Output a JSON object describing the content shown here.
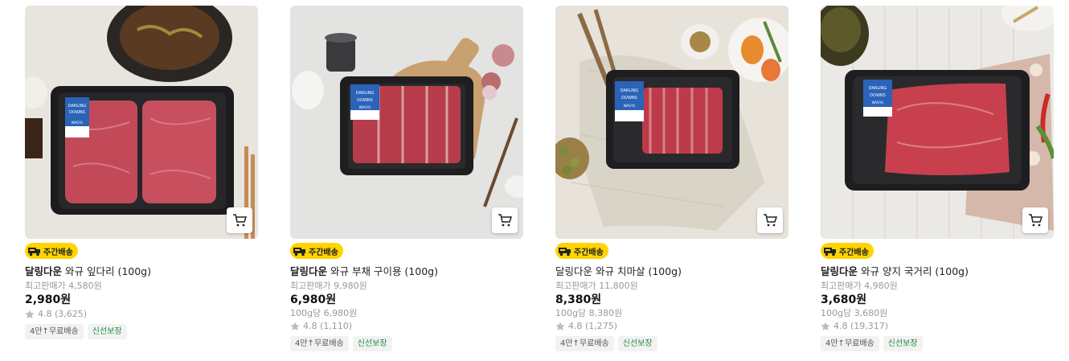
{
  "products": [
    {
      "badge": "주간배송",
      "brand": "달링다운",
      "name": "와규 잎다리 (100g)",
      "original_price": "최고판매가 4,580원",
      "price": "2,980원",
      "unit_price": "",
      "rating": "4.8 (3,625)",
      "tags": [
        "4만↑무료배송",
        "신선보장"
      ]
    },
    {
      "badge": "주간배송",
      "brand": "달링다운",
      "name": "와규 부채 구이용 (100g)",
      "original_price": "최고판매가 9,980원",
      "price": "6,980원",
      "unit_price": "100g당 6,980원",
      "rating": "4.8 (1,110)",
      "tags": [
        "4만↑무료배송",
        "신선보장"
      ]
    },
    {
      "badge": "주간배송",
      "brand": "달링다운",
      "name": "와규 치마살 (100g)",
      "original_price": "최고판매가 11,800원",
      "price": "8,380원",
      "unit_price": "100g당 8,380원",
      "rating": "4.8 (1,275)",
      "tags": [
        "4만↑무료배송",
        "신선보장"
      ]
    },
    {
      "badge": "주간배송",
      "brand": "달링다운",
      "name": "와규 양지 국거리 (100g)",
      "original_price": "최고판매가 4,980원",
      "price": "3,680원",
      "unit_price": "100g당 3,680원",
      "rating": "4.8 (19,317)",
      "tags": [
        "4만↑무료배송",
        "신선보장"
      ]
    }
  ],
  "package_label": {
    "line1": "DARLING",
    "line2": "DOWNS",
    "line3": "WAGYU"
  },
  "colors": {
    "badge_yellow": "#ffd400",
    "fresh_green": "#1f8a3c",
    "label_blue": "#2a63b8"
  },
  "icons": {
    "cart": "cart-icon",
    "truck": "truck-icon",
    "star": "star-icon"
  }
}
